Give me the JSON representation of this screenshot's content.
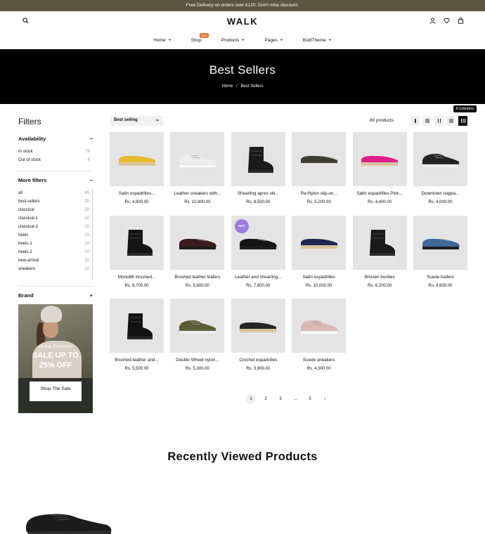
{
  "announcement": "Free Delivery on orders over £120. Don't miss discount.",
  "brand": {
    "logo": "WALK"
  },
  "nav": [
    {
      "label": "Home",
      "badge": ""
    },
    {
      "label": "Shop",
      "badge": "HOT"
    },
    {
      "label": "Products",
      "badge": ""
    },
    {
      "label": "Pages",
      "badge": ""
    },
    {
      "label": "BuiltTheme",
      "badge": ""
    }
  ],
  "banner": {
    "title": "Best Sellers",
    "crumb_home": "Home",
    "crumb_sep": "/",
    "crumb_current": "Best Sellers"
  },
  "filters": {
    "title": "Filters",
    "availability": {
      "label": "Availability",
      "toggle": "−",
      "items": [
        {
          "label": "In stock",
          "count": "76"
        },
        {
          "label": "Out of stock",
          "count": "4"
        }
      ]
    },
    "more": {
      "label": "More filters",
      "toggle": "−",
      "items": [
        {
          "label": "all",
          "count": "80"
        },
        {
          "label": "best-sellers",
          "count": "20"
        },
        {
          "label": "classical",
          "count": "20"
        },
        {
          "label": "classical-1",
          "count": "10"
        },
        {
          "label": "classical-2",
          "count": "10"
        },
        {
          "label": "heels",
          "count": "20"
        },
        {
          "label": "heels-1",
          "count": "10"
        },
        {
          "label": "heels-2",
          "count": "10"
        },
        {
          "label": "new-arrival",
          "count": "20"
        },
        {
          "label": "sneakers",
          "count": "20"
        }
      ]
    },
    "brand": {
      "label": "Brand",
      "toggle": "+"
    }
  },
  "promo": {
    "line1": "Online Exclusive",
    "line2": "SALE UP TO",
    "line3": "25% OFF",
    "button": "Shop The Sale"
  },
  "toolbar": {
    "sort_label": "Best selling",
    "count": "80 products",
    "tooltip": "6 columns",
    "views": [
      "list",
      "grid-2",
      "grid-3",
      "grid-4",
      "grid-6"
    ]
  },
  "products": [
    {
      "name": "Satin espadrilles...",
      "price": "Rs. 4,800.00",
      "badge": "",
      "shoe": "espadrille",
      "color": "#e6b82e"
    },
    {
      "name": "Leather sneakers with...",
      "price": "Rs. 10,800.00",
      "badge": "",
      "shoe": "sneaker",
      "color": "#ededed"
    },
    {
      "name": "Shearling apres ski...",
      "price": "Rs. 8,500.00",
      "badge": "",
      "shoe": "boot",
      "color": "#1b1b1b"
    },
    {
      "name": "Re-Nylon slip-on...",
      "price": "Rs. 5,200.00",
      "badge": "",
      "shoe": "slipon",
      "color": "#3d4030"
    },
    {
      "name": "Satin espadrilles Pink...",
      "price": "Rs. 4,400.00",
      "badge": "",
      "shoe": "espadrille",
      "color": "#e01f8a"
    },
    {
      "name": "Downtown nappa...",
      "price": "Rs. 4,000.00",
      "badge": "",
      "shoe": "sneaker",
      "color": "#222222"
    },
    {
      "name": "Monolith brushed...",
      "price": "Rs. 6,700.00",
      "badge": "",
      "shoe": "boot",
      "color": "#151515"
    },
    {
      "name": "Brushed leather loafers",
      "price": "Rs. 5,900.00",
      "badge": "",
      "shoe": "loafer",
      "color": "#3b1b1b"
    },
    {
      "name": "Leather and shearling...",
      "price": "Rs. 7,800.00",
      "badge": "HOT",
      "shoe": "loafer",
      "color": "#141414"
    },
    {
      "name": "Satin espadrilles",
      "price": "Rs. 10,000.00",
      "badge": "",
      "shoe": "espadrille",
      "color": "#1e2550"
    },
    {
      "name": "Brixxen booties",
      "price": "Rs. 8,200.00",
      "badge": "",
      "shoe": "boot",
      "color": "#1a1a1a"
    },
    {
      "name": "Suede loafers",
      "price": "Rs. 4,600.00",
      "badge": "",
      "shoe": "loafer",
      "color": "#3f6a96"
    },
    {
      "name": "Brushed-leather and...",
      "price": "Rs. 5,500.00",
      "badge": "",
      "shoe": "boot",
      "color": "#111111"
    },
    {
      "name": "Double Wheel nylon...",
      "price": "Rs. 5,300.00",
      "badge": "",
      "shoe": "sneaker",
      "color": "#5a5c33"
    },
    {
      "name": "Crochet espadrilles",
      "price": "Rs. 3,900.00",
      "badge": "",
      "shoe": "espadrille",
      "color": "#262626"
    },
    {
      "name": "Suede sneakers",
      "price": "Rs. 4,300.00",
      "badge": "",
      "shoe": "sneaker",
      "color": "#d9b9b5"
    }
  ],
  "pagination": [
    "1",
    "2",
    "3",
    "...",
    "5",
    "›"
  ],
  "recently_viewed": {
    "title": "Recently Viewed Products"
  }
}
